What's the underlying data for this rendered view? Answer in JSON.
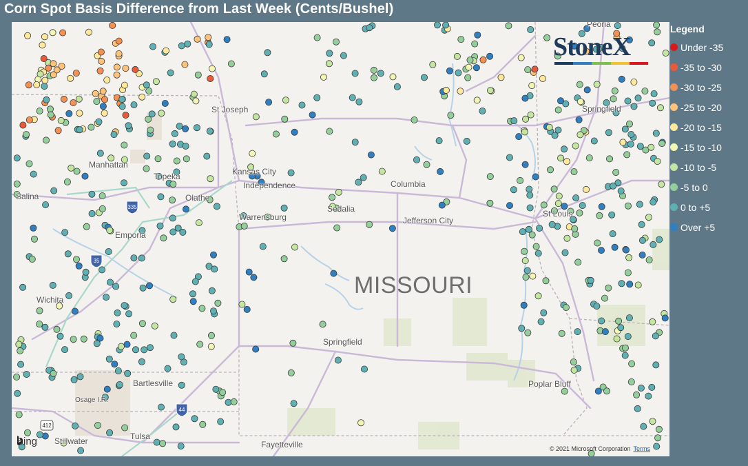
{
  "title": "Corn Spot Basis Difference from Last Week (Cents/Bushel)",
  "legend": {
    "title": "Legend",
    "items": [
      {
        "label": "Under -35",
        "color": "#d7191c"
      },
      {
        "label": "-35 to -30",
        "color": "#e85b3a"
      },
      {
        "label": "-30 to -25",
        "color": "#f59053"
      },
      {
        "label": "-25 to -20",
        "color": "#fdc37a"
      },
      {
        "label": "-20 to -15",
        "color": "#fee89b"
      },
      {
        "label": "-15 to -10",
        "color": "#f2f5b4"
      },
      {
        "label": "-10 to -5",
        "color": "#c4e6a0"
      },
      {
        "label": "-5 to 0",
        "color": "#94cf9b"
      },
      {
        "label": "0 to +5",
        "color": "#5fb0b3"
      },
      {
        "label": "Over +5",
        "color": "#2f7fc1"
      }
    ]
  },
  "map": {
    "state_label": "MISSOURI",
    "places": [
      "St Joseph",
      "Manhattan",
      "Topeka",
      "Kansas City",
      "Independence",
      "Salina",
      "Olathe",
      "Columbia",
      "Sedalia",
      "Warrensburg",
      "Jefferson City",
      "St Louis",
      "Emporia",
      "Springfield",
      "Wichita",
      "Springfield",
      "Bartlesville",
      "Osage I.R.",
      "Poplar Bluff",
      "Tulsa",
      "Stillwater",
      "Fayetteville",
      "Peoria"
    ],
    "highway_shields": [
      "335",
      "35",
      "412",
      "44"
    ],
    "logo_text": "StoneX",
    "logo_colors": [
      "#1f3a5a",
      "#2f7fc1",
      "#7fbf4d",
      "#f2c230",
      "#d7191c"
    ],
    "provider": "Bing",
    "copyright": "© 2021 Microsoft Corporation",
    "terms_label": "Terms"
  }
}
